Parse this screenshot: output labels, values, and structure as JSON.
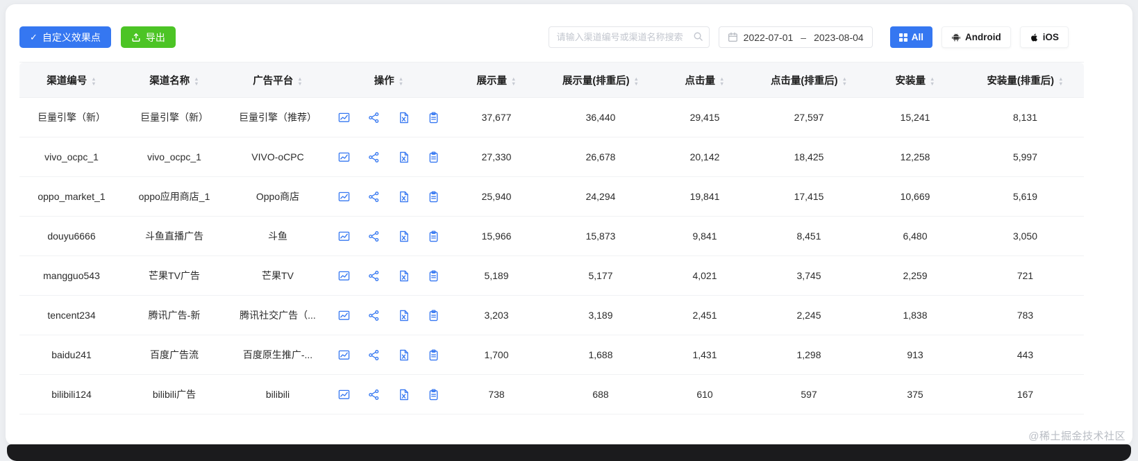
{
  "toolbar": {
    "customize_label": "自定义效果点",
    "export_label": "导出",
    "search_placeholder": "请输入渠道编号或渠道名称搜索",
    "date_start": "2022-07-01",
    "date_separator": "–",
    "date_end": "2023-08-04",
    "filter_all": "All",
    "filter_android": "Android",
    "filter_ios": "iOS"
  },
  "colors": {
    "primary_blue": "#3577f1",
    "export_green": "#4cc425",
    "operation_icon_blue": "#3577f1",
    "header_bg": "#f6f7f9"
  },
  "icons": {
    "customize": "check-icon",
    "export": "export-icon",
    "search": "search-icon",
    "date": "calendar-icon",
    "all": "grid-icon",
    "android": "android-icon",
    "ios": "apple-icon",
    "sort": "sort-caret-icon",
    "operations": [
      "chart-icon",
      "share-icon",
      "excel-icon",
      "clipboard-icon"
    ]
  },
  "table": {
    "headers": [
      {
        "key": "channel_id",
        "label": "渠道编号"
      },
      {
        "key": "channel_name",
        "label": "渠道名称"
      },
      {
        "key": "platform",
        "label": "广告平台"
      },
      {
        "key": "ops",
        "label": "操作"
      },
      {
        "key": "impressions",
        "label": "展示量"
      },
      {
        "key": "impressions_dedup",
        "label": "展示量(排重后)"
      },
      {
        "key": "clicks",
        "label": "点击量"
      },
      {
        "key": "clicks_dedup",
        "label": "点击量(排重后)"
      },
      {
        "key": "installs",
        "label": "安装量"
      },
      {
        "key": "installs_dedup",
        "label": "安装量(排重后)"
      }
    ],
    "rows": [
      {
        "channel_id": "巨量引擎（新）",
        "channel_name": "巨量引擎（新）",
        "platform": "巨量引擎（推荐）",
        "impressions": "37,677",
        "impressions_dedup": "36,440",
        "clicks": "29,415",
        "clicks_dedup": "27,597",
        "installs": "15,241",
        "installs_dedup": "8,131"
      },
      {
        "channel_id": "vivo_ocpc_1",
        "channel_name": "vivo_ocpc_1",
        "platform": "VIVO-oCPC",
        "impressions": "27,330",
        "impressions_dedup": "26,678",
        "clicks": "20,142",
        "clicks_dedup": "18,425",
        "installs": "12,258",
        "installs_dedup": "5,997"
      },
      {
        "channel_id": "oppo_market_1",
        "channel_name": "oppo应用商店_1",
        "platform": "Oppo商店",
        "impressions": "25,940",
        "impressions_dedup": "24,294",
        "clicks": "19,841",
        "clicks_dedup": "17,415",
        "installs": "10,669",
        "installs_dedup": "5,619"
      },
      {
        "channel_id": "douyu6666",
        "channel_name": "斗鱼直播广告",
        "platform": "斗鱼",
        "impressions": "15,966",
        "impressions_dedup": "15,873",
        "clicks": "9,841",
        "clicks_dedup": "8,451",
        "installs": "6,480",
        "installs_dedup": "3,050"
      },
      {
        "channel_id": "mangguo543",
        "channel_name": "芒果TV广告",
        "platform": "芒果TV",
        "impressions": "5,189",
        "impressions_dedup": "5,177",
        "clicks": "4,021",
        "clicks_dedup": "3,745",
        "installs": "2,259",
        "installs_dedup": "721"
      },
      {
        "channel_id": "tencent234",
        "channel_name": "腾讯广告-新",
        "platform": "腾讯社交广告（...",
        "impressions": "3,203",
        "impressions_dedup": "3,189",
        "clicks": "2,451",
        "clicks_dedup": "2,245",
        "installs": "1,838",
        "installs_dedup": "783"
      },
      {
        "channel_id": "baidu241",
        "channel_name": "百度广告流",
        "platform": "百度原生推广-...",
        "impressions": "1,700",
        "impressions_dedup": "1,688",
        "clicks": "1,431",
        "clicks_dedup": "1,298",
        "installs": "913",
        "installs_dedup": "443"
      },
      {
        "channel_id": "bilibili124",
        "channel_name": "bilibili广告",
        "platform": "bilibili",
        "impressions": "738",
        "impressions_dedup": "688",
        "clicks": "610",
        "clicks_dedup": "597",
        "installs": "375",
        "installs_dedup": "167"
      }
    ]
  },
  "watermark": "@稀土掘金技术社区"
}
